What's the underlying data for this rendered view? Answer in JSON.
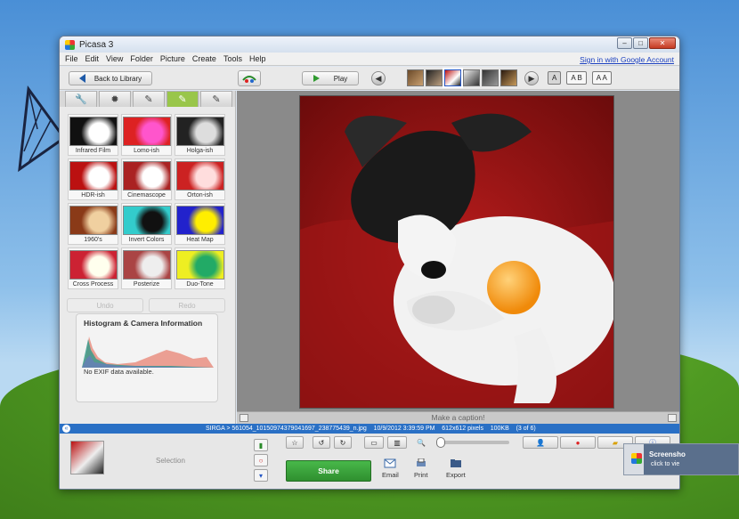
{
  "window": {
    "title": "Picasa 3"
  },
  "menu": [
    "File",
    "Edit",
    "View",
    "Folder",
    "Picture",
    "Create",
    "Tools",
    "Help"
  ],
  "account_link": "Sign in with Google Account",
  "toolbar": {
    "back_label": "Back to Library",
    "play_label": "Play"
  },
  "view_modes": [
    "A",
    "A B",
    "A A"
  ],
  "effects": [
    {
      "label": "Infrared Film",
      "colors": [
        "#111",
        "#fff"
      ]
    },
    {
      "label": "Lomo-ish",
      "colors": [
        "#d22",
        "#f5c"
      ]
    },
    {
      "label": "Holga-ish",
      "colors": [
        "#222",
        "#ddd"
      ]
    },
    {
      "label": "HDR-ish",
      "colors": [
        "#b11",
        "#fff"
      ]
    },
    {
      "label": "Cinemascope",
      "colors": [
        "#a22",
        "#fff"
      ]
    },
    {
      "label": "Orton-ish",
      "colors": [
        "#c22",
        "#fdd"
      ]
    },
    {
      "label": "1960's",
      "colors": [
        "#8a3a18",
        "#f0d0a0"
      ]
    },
    {
      "label": "Invert Colors",
      "colors": [
        "#3cc",
        "#111"
      ]
    },
    {
      "label": "Heat Map",
      "colors": [
        "#22c",
        "#fe0"
      ]
    },
    {
      "label": "Cross Process",
      "colors": [
        "#c23",
        "#ffe"
      ]
    },
    {
      "label": "Posterize",
      "colors": [
        "#a44",
        "#eee"
      ]
    },
    {
      "label": "Duo-Tone",
      "colors": [
        "#ee2",
        "#2a6"
      ]
    }
  ],
  "edit_buttons": {
    "undo": "Undo",
    "redo": "Redo"
  },
  "histogram": {
    "title": "Histogram & Camera Information",
    "exif": "No EXIF data available."
  },
  "caption": {
    "placeholder": "Make a caption!"
  },
  "status": {
    "path": "SIRGA > 561054_10150974379041697_238775439_n.jpg",
    "date": "10/9/2012 3:39:59 PM",
    "dimensions": "612x612 pixels",
    "size": "100KB",
    "position": "(3 of 6)"
  },
  "tray": {
    "selection_label": "Selection"
  },
  "actions": {
    "share": "Share",
    "email": "Email",
    "print": "Print",
    "export": "Export"
  },
  "notification": {
    "title": "Screensho",
    "subtitle": "click to vie"
  }
}
